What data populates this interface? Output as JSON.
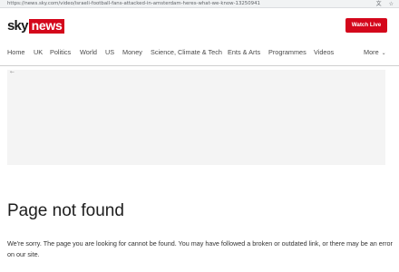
{
  "browser": {
    "url": "https://news.sky.com/video/israeli-football-fans-attacked-in-amsterdam-heres-what-we-know-13250941",
    "icons": [
      "translate-icon",
      "star-icon"
    ]
  },
  "header": {
    "logo_sky": "sky",
    "logo_news": "news",
    "watch_live": "Watch Live",
    "brand_color": "#d4071b"
  },
  "nav": {
    "items": [
      "Home",
      "UK",
      "Politics",
      "World",
      "US",
      "Money",
      "Science, Climate & Tech",
      "Ents & Arts",
      "Programmes",
      "Videos"
    ],
    "more": "More"
  },
  "main": {
    "title": "Page not found",
    "message": "We're sorry. The page you are looking for cannot be found. You may have followed a broken or outdated link, or there may be an error on our site."
  }
}
